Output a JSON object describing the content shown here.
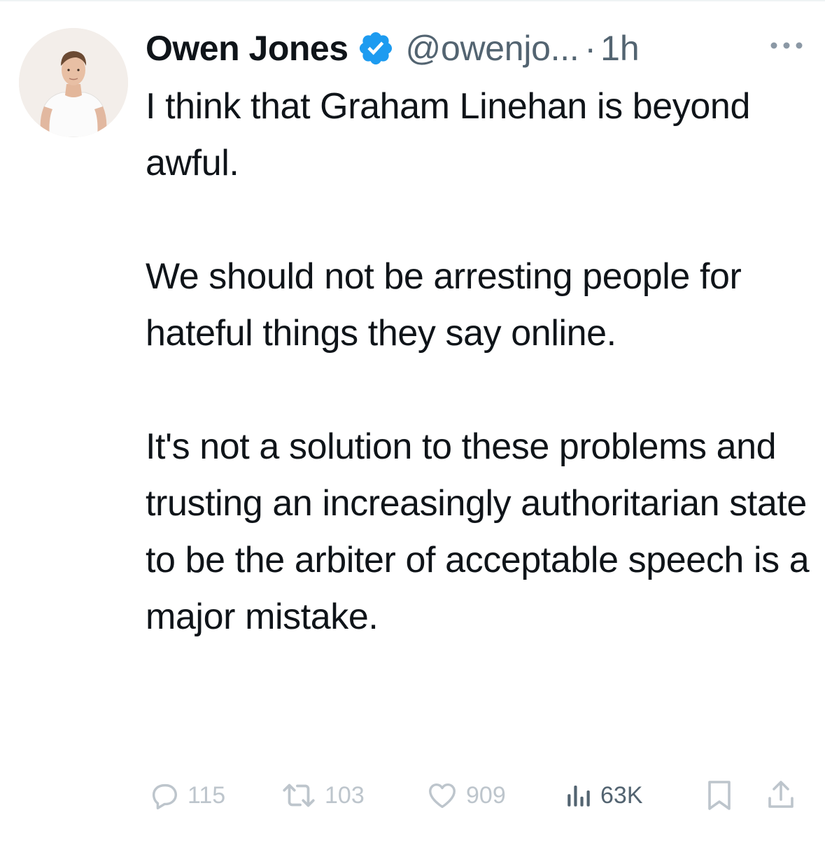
{
  "author": {
    "display_name": "Owen Jones",
    "handle": "@owenjo...",
    "separator": "·",
    "time": "1h",
    "verified": true
  },
  "tweet": {
    "paragraphs": [
      "I think that Graham Linehan is beyond awful.",
      "We should not be arresting people for hateful things they say online.",
      "It's not a solution to these problems and trusting an increasingly authoritarian state to be the arbiter of acceptable speech is a major mistake."
    ]
  },
  "actions": {
    "replies": "115",
    "retweets": "103",
    "likes": "909",
    "views": "63K"
  },
  "icons": {
    "verified": "verified-badge-icon",
    "more": "more-options-icon",
    "reply": "reply-icon",
    "retweet": "retweet-icon",
    "like": "heart-icon",
    "views": "views-icon",
    "bookmark": "bookmark-icon",
    "share": "share-icon"
  },
  "colors": {
    "verified_blue": "#1d9bf0",
    "text_primary": "#0f1419",
    "text_secondary": "#536471",
    "action_faded": "#bdc5cc"
  }
}
